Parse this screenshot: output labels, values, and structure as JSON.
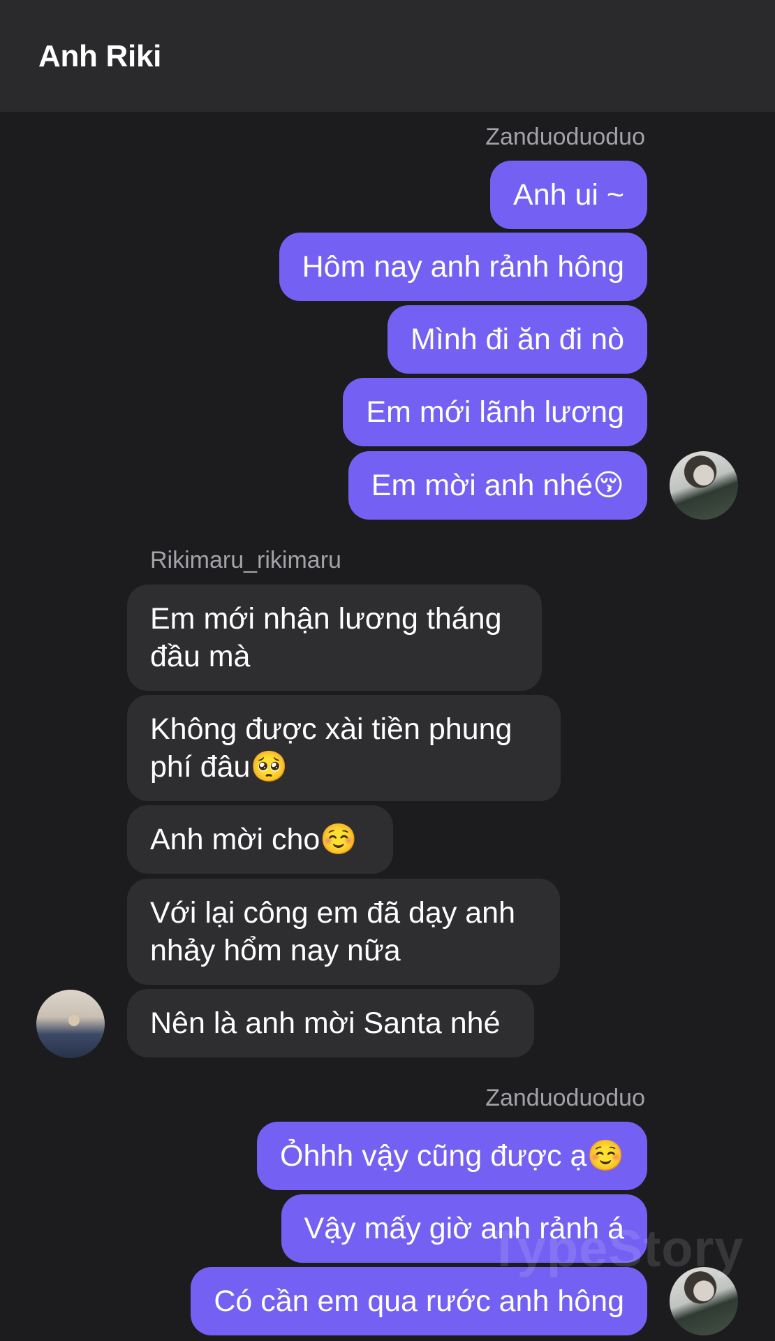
{
  "header": {
    "title": "Anh Riki"
  },
  "groups": [
    {
      "sender": "Zanduoduoduo",
      "messages": [
        "Anh ui ~",
        "Hôm nay anh rảnh hông",
        "Mình đi ăn đi nò",
        "Em mới lãnh lương",
        "Em mời anh nhé😚"
      ]
    },
    {
      "sender": "Rikimaru_rikimaru",
      "messages": [
        "Em mới nhận lương tháng đầu mà",
        "Không được xài tiền phung phí đâu🥺",
        "Anh mời cho☺️",
        "Với lại công em đã dạy anh nhảy hổm nay nữa",
        "Nên là anh mời Santa nhé"
      ]
    },
    {
      "sender": "Zanduoduoduo",
      "messages": [
        "Ỏhhh vậy cũng được ạ☺️",
        "Vậy mấy giờ anh rảnh á",
        "Có cần em qua rước anh hông"
      ]
    }
  ],
  "watermark": "TypeStory",
  "colors": {
    "outgoing": "#7460f2",
    "incoming": "#2e2e31",
    "background": "#1c1c1e",
    "header": "#2a2a2d"
  }
}
